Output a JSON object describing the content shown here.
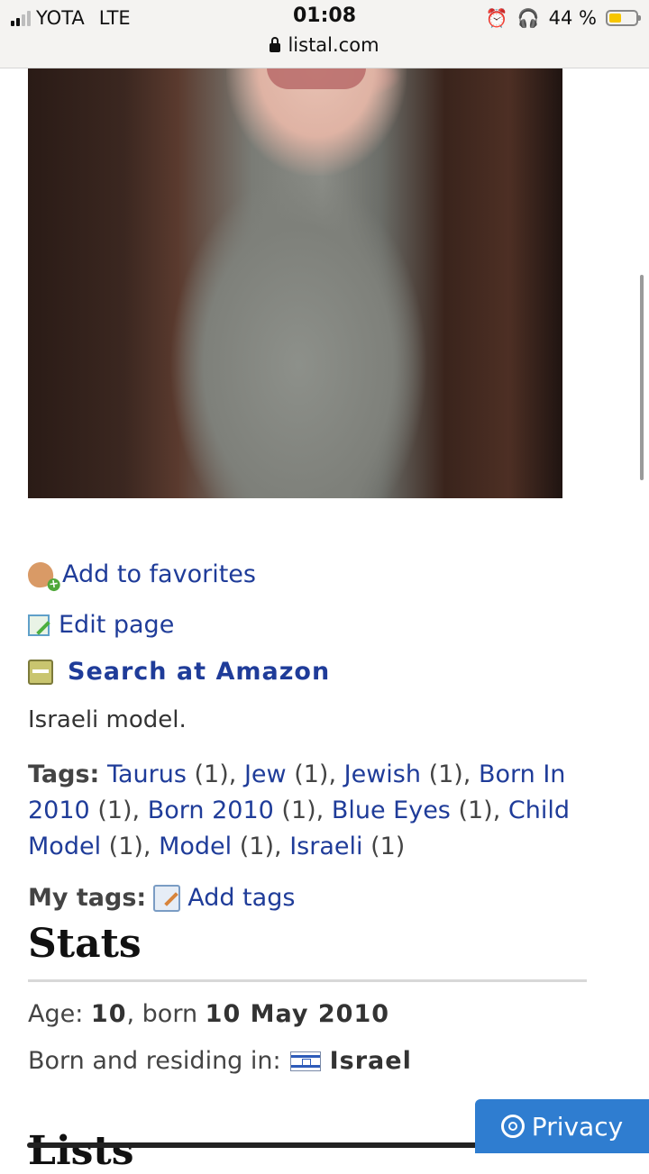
{
  "status_bar": {
    "carrier": "YOTA",
    "network": "LTE",
    "time": "01:08",
    "battery": "44 %",
    "url": "listal.com"
  },
  "actions": {
    "favorites": "Add to favorites",
    "edit": "Edit page",
    "amazon": "Search at Amazon"
  },
  "description": "Israeli model.",
  "tags": {
    "label": "Tags:",
    "items": [
      {
        "name": "Taurus",
        "count": "(1),"
      },
      {
        "name": "Jew",
        "count": "(1),"
      },
      {
        "name": "Jewish",
        "count": "(1),"
      },
      {
        "name": "Born In 2010",
        "count": "(1),"
      },
      {
        "name": "Born 2010",
        "count": "(1),"
      },
      {
        "name": "Blue Eyes",
        "count": "(1),"
      },
      {
        "name": "Child Model",
        "count": "(1),"
      },
      {
        "name": "Model",
        "count": "(1),"
      },
      {
        "name": "Israeli",
        "count": "(1)"
      }
    ]
  },
  "my_tags": {
    "label": "My tags:",
    "add": "Add tags"
  },
  "stats": {
    "title": "Stats",
    "age_label": "Age:",
    "age_value": "10",
    "born_sep": ", born",
    "born_date": "10 May 2010",
    "residence_label": "Born and residing in:",
    "residence_value": "Israel"
  },
  "lists": {
    "title": "Lists"
  },
  "privacy": {
    "label": "Privacy"
  }
}
